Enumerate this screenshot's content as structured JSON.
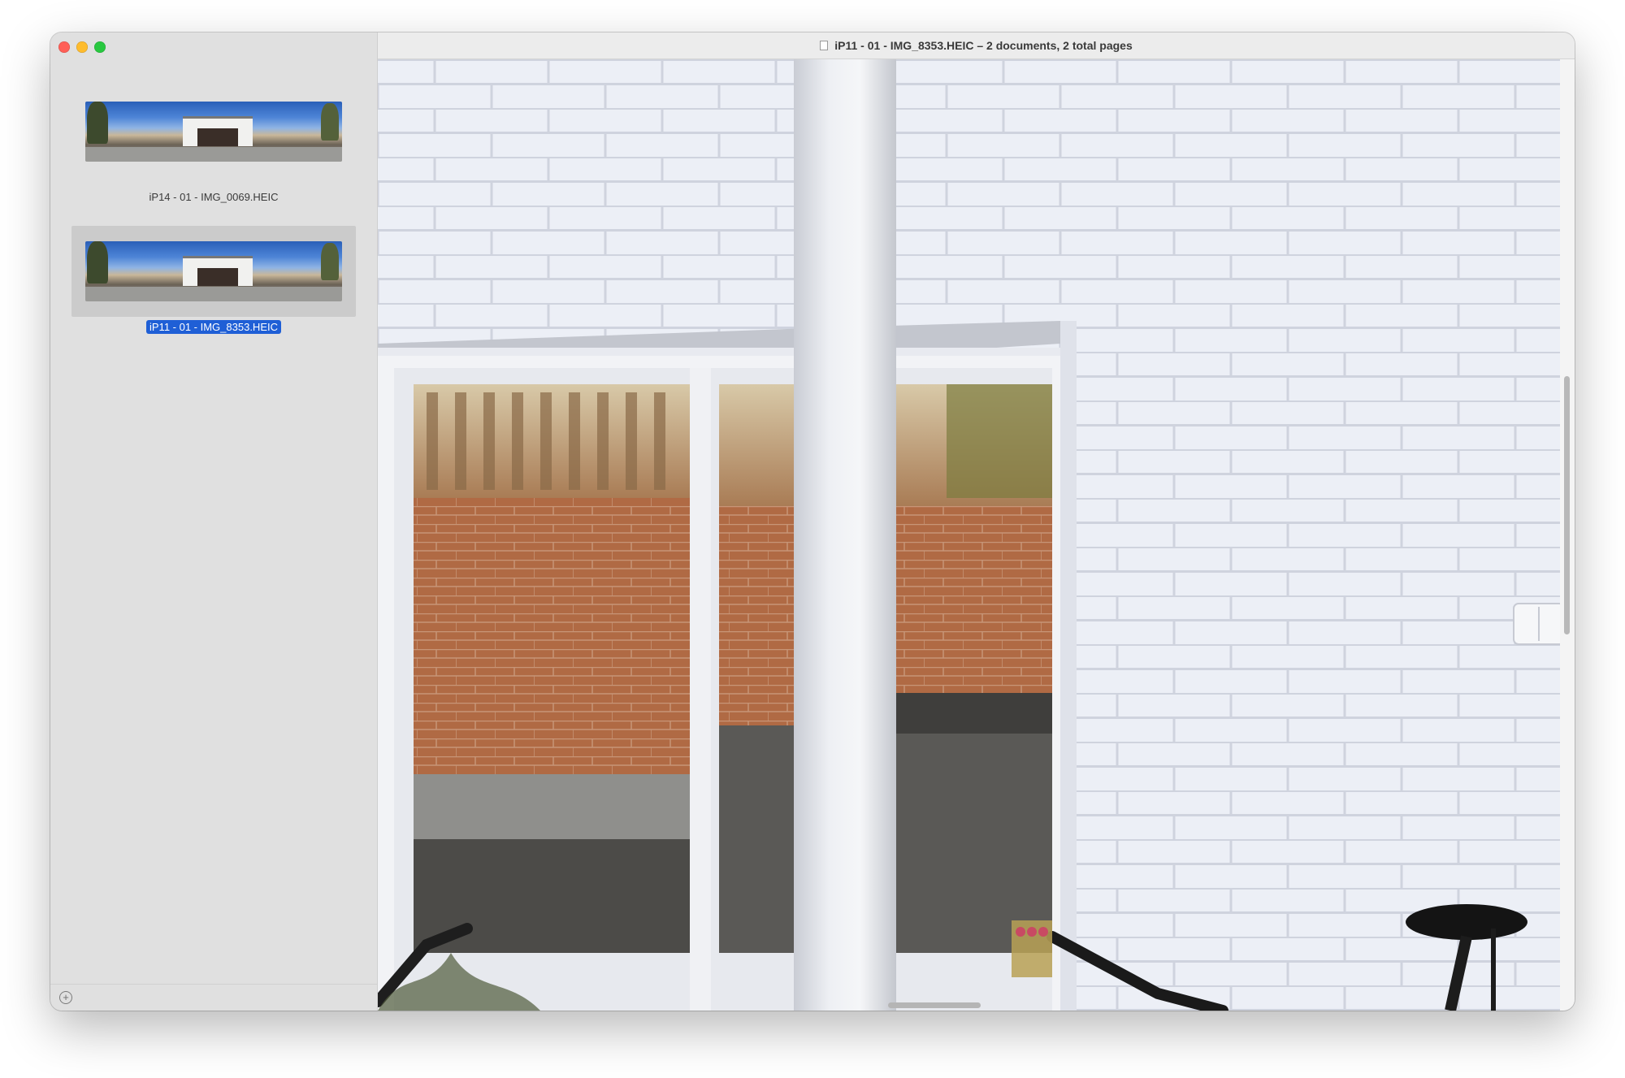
{
  "window": {
    "title": "iP11 - 01 - IMG_8353.HEIC – 2 documents, 2 total pages"
  },
  "sidebar": {
    "items": [
      {
        "label": "iP14 - 01 - IMG_0069.HEIC",
        "selected": false
      },
      {
        "label": "iP11 - 01 - IMG_8353.HEIC",
        "selected": true
      }
    ],
    "add_icon": "plus-circle-icon"
  },
  "colors": {
    "selection": "#1f5fd6",
    "wall": "#eef0f6",
    "brick": "#b5673e",
    "traffic_red": "#ff5f57",
    "traffic_yellow": "#febc2e",
    "traffic_green": "#28c840"
  }
}
